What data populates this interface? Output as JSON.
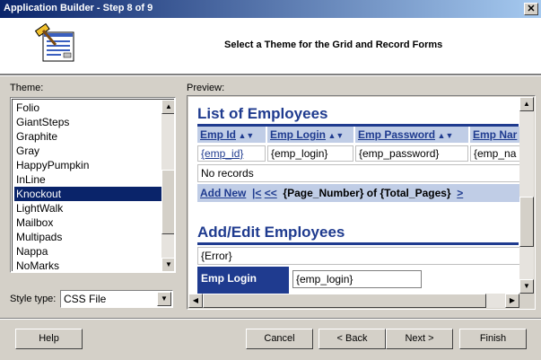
{
  "window": {
    "title": "Application Builder - Step 8 of 9",
    "close": "✕"
  },
  "header": {
    "title": "Select a Theme for the Grid and Record Forms"
  },
  "theme": {
    "label": "Theme:",
    "items": [
      "Folio",
      "GiantSteps",
      "Graphite",
      "Gray",
      "HappyPumpkin",
      "InLine",
      "Knockout",
      "LightWalk",
      "Mailbox",
      "Multipads",
      "Nappa",
      "NoMarks"
    ],
    "selected": "Knockout"
  },
  "style": {
    "label": "Style type:",
    "value": "CSS File",
    "options": [
      "CSS File"
    ]
  },
  "preview": {
    "label": "Preview:",
    "list_title": "List of Employees",
    "columns": [
      "Emp Id",
      "Emp Login",
      "Emp Password",
      "Emp Nar"
    ],
    "row": [
      "{emp_id}",
      "{emp_login}",
      "{emp_password}",
      "{emp_na"
    ],
    "no_records": "No records",
    "add_new": "Add New",
    "pager_first": "|<",
    "pager_prev": "<<",
    "pager_text": "{Page_Number} of {Total_Pages}",
    "pager_next": ">",
    "edit_title": "Add/Edit Employees",
    "error": "{Error}",
    "field_label": "Emp Login",
    "field_value": "{emp_login}"
  },
  "buttons": {
    "help": "Help",
    "cancel": "Cancel",
    "back": "< Back",
    "next": "Next >",
    "finish": "Finish"
  },
  "colors": {
    "title_bar": "#0a246a",
    "accent": "#1f3b8f",
    "selection": "#0a246a"
  }
}
